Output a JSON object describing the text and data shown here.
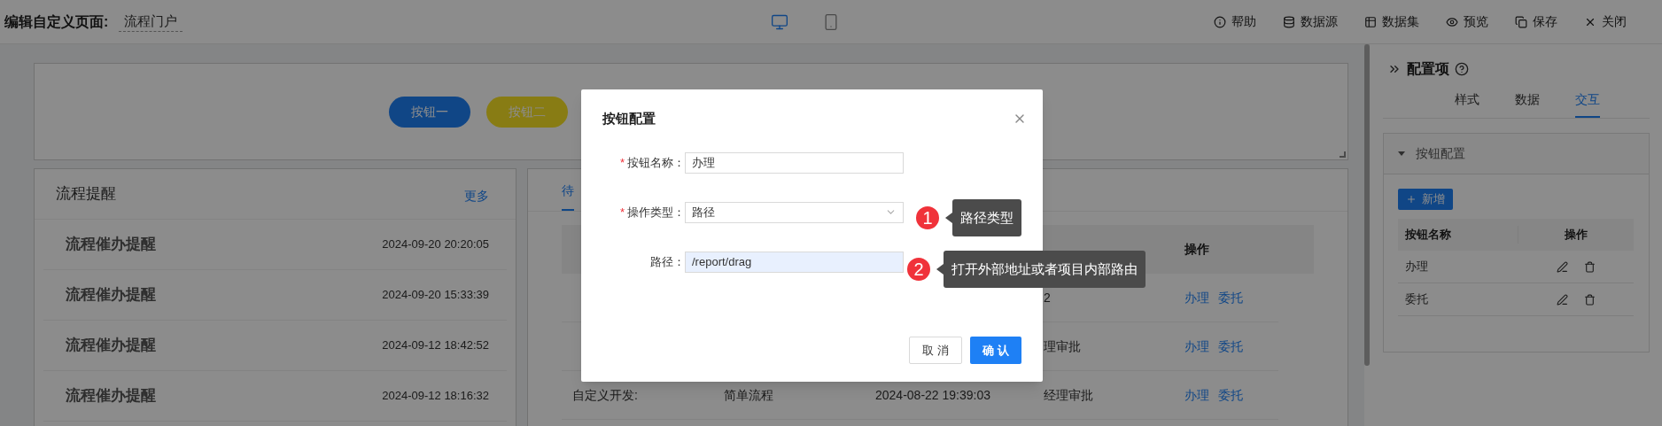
{
  "header": {
    "title": "编辑自定义页面:",
    "page_name": "流程门户",
    "devices": [
      {
        "kind": "desktop",
        "selected": true
      },
      {
        "kind": "mobile",
        "selected": false
      }
    ],
    "actions": [
      {
        "kind": "info",
        "label": "帮助"
      },
      {
        "kind": "database",
        "label": "数据源"
      },
      {
        "kind": "table",
        "label": "数据集"
      },
      {
        "kind": "eye",
        "label": "预览"
      },
      {
        "kind": "copy",
        "label": "保存"
      },
      {
        "kind": "close",
        "label": "关闭"
      }
    ]
  },
  "canvas": {
    "buttons": [
      {
        "label": "按钮一",
        "kind": "primary"
      },
      {
        "label": "按钮二",
        "kind": "warning"
      }
    ]
  },
  "reminders": {
    "title": "流程提醒",
    "more": "更多",
    "items": [
      {
        "title": "流程催办提醒",
        "time": "2024-09-20 20:20:05"
      },
      {
        "title": "流程催办提醒",
        "time": "2024-09-20 15:33:39"
      },
      {
        "title": "流程催办提醒",
        "time": "2024-09-12 18:42:52"
      },
      {
        "title": "流程催办提醒",
        "time": "2024-09-12 18:16:32"
      }
    ]
  },
  "tasks": {
    "tabs": [
      {
        "label": "待",
        "selected": true
      }
    ],
    "header": {
      "column_5": "操作"
    },
    "rows": [
      {
        "column_4": "2",
        "actions": [
          "办理",
          "委托"
        ]
      },
      {
        "column_4": "理审批",
        "actions": [
          "办理",
          "委托"
        ]
      },
      {
        "column_1": "自定义开发:",
        "column_2": "简单流程",
        "column_3": "2024-08-22 19:39:03",
        "column_4": "经理审批",
        "actions": [
          "办理",
          "委托"
        ]
      }
    ]
  },
  "config_panel": {
    "title": "配置项",
    "tabs": [
      {
        "label": "样式",
        "selected": false
      },
      {
        "label": "数据",
        "selected": false
      },
      {
        "label": "交互",
        "selected": true
      }
    ],
    "section": {
      "title": "按钮配置",
      "expanded": true,
      "add_button": "新增",
      "columns": [
        "按钮名称",
        "操作"
      ],
      "rows": [
        {
          "name": "办理"
        },
        {
          "name": "委托"
        }
      ]
    }
  },
  "dialog": {
    "title": "按钮配置",
    "fields": [
      {
        "marker": "*",
        "label": "按钮名称：",
        "kind": "input",
        "value": "办理",
        "highlighted": false
      },
      {
        "marker": "*",
        "label": "操作类型：",
        "kind": "select",
        "value": "路径"
      },
      {
        "label": "路径：",
        "kind": "input",
        "value": "/report/drag",
        "highlighted": true
      }
    ],
    "buttons": [
      {
        "label": "取 消",
        "kind": "default"
      },
      {
        "label": "确 认",
        "kind": "primary"
      }
    ]
  },
  "annotations": [
    {
      "number": "1",
      "text": "路径类型"
    },
    {
      "number": "2",
      "text": "打开外部地址或者项目内部路由"
    }
  ]
}
